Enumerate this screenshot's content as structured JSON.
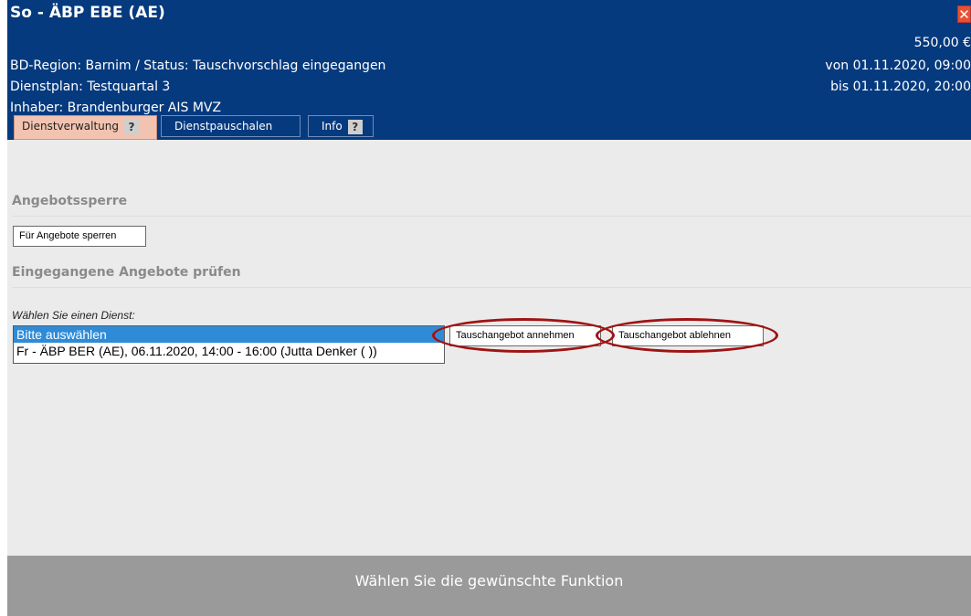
{
  "header": {
    "title": "So - ÄBP EBE (AE)",
    "price": "550,00 €",
    "region_status": "BD-Region: Barnim / Status: Tauschvorschlag eingegangen",
    "dienstplan": "Dienstplan: Testquartal 3",
    "inhaber": "Inhaber: Brandenburger AIS MVZ",
    "von": "von 01.11.2020, 09:00",
    "bis": "bis 01.11.2020, 20:00",
    "close_symbol": "✕"
  },
  "tabs": [
    {
      "label": "Dienstverwaltung",
      "help": "?"
    },
    {
      "label": "Dienstpauschalen"
    },
    {
      "label": "Info",
      "help": "?"
    }
  ],
  "sections": {
    "angebotssperre": {
      "title": "Angebotssperre",
      "button": "Für Angebote sperren"
    },
    "angebote": {
      "title": "Eingegangene Angebote prüfen",
      "label": "Wählen Sie einen Dienst:",
      "options": [
        "Bitte auswählen",
        "Fr - ÄBP BER (AE), 06.11.2020, 14:00 - 16:00 (Jutta Denker ( ))"
      ],
      "accept_button": "Tauschangebot annehmen",
      "decline_button": "Tauschangebot ablehnen"
    }
  },
  "footer": {
    "text": "Wählen Sie die gewünschte Funktion"
  },
  "colors": {
    "header_bg": "#063a7e",
    "active_tab": "#f2c3b0",
    "highlight_oval": "#a01313",
    "footer_bg": "#9a9a9a"
  }
}
